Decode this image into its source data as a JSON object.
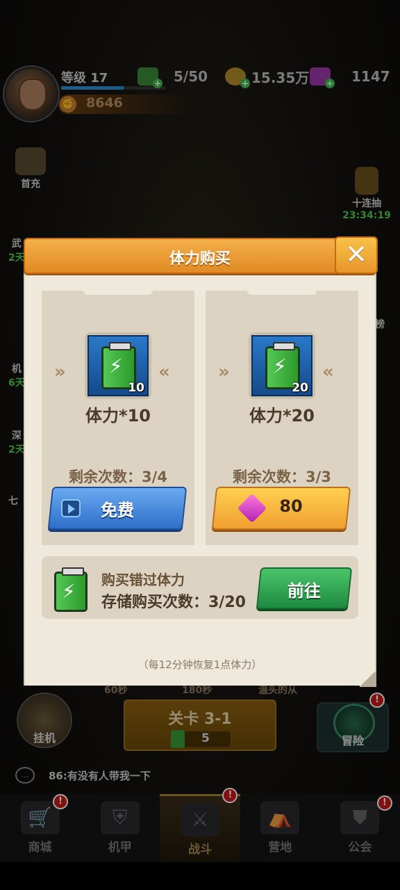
{
  "topbar": {
    "level_label": "等级 17",
    "power": "8646",
    "stamina": "5/50",
    "gold": "15.35万",
    "gems": "1147",
    "plus": "+"
  },
  "side_events": {
    "first_charge": "首充",
    "ten_draw": "十连抽",
    "ten_draw_timer": "23:34:19",
    "partial_left": [
      "武",
      "2天",
      "机",
      "6天",
      "深",
      "2天",
      "七"
    ],
    "partial_right": [
      "榜"
    ]
  },
  "bottom": {
    "hangup_label": "挂机",
    "stage_label": "关卡 3-1",
    "stage_cost": "5",
    "adventure_label": "冒险",
    "badge": "!",
    "behind_texts": [
      "60秒",
      "180秒",
      "温头的从"
    ],
    "chat_message": "86:有没有人带我一下",
    "chat_icon": "..."
  },
  "nav": {
    "items": [
      {
        "label": "商城",
        "icon": "cart-icon"
      },
      {
        "label": "机甲",
        "icon": "mech-icon"
      },
      {
        "label": "战斗",
        "icon": "battle-icon"
      },
      {
        "label": "营地",
        "icon": "camp-icon"
      },
      {
        "label": "公会",
        "icon": "guild-icon"
      }
    ],
    "active": "战斗"
  },
  "dialog": {
    "title": "体力购买",
    "close": "✕",
    "cards": [
      {
        "quantity": "10",
        "name": "体力*10",
        "remaining": "剩余次数：3/4",
        "button": "免费",
        "button_type": "free-video"
      },
      {
        "quantity": "20",
        "name": "体力*20",
        "remaining": "剩余次数：3/3",
        "button": "80",
        "button_type": "gem-cost"
      }
    ],
    "arrows_left": "»",
    "arrows_right": "«",
    "storage": {
      "line1": "购买错过体力",
      "line2": "存储购买次数：3/20",
      "button": "前往"
    },
    "footnote": "（每12分钟恢复1点体力）"
  },
  "colors": {
    "header_orange": "#e08a24",
    "panel_bg": "#efe9dc",
    "card_bg": "#dcd3c2",
    "free_blue": "#2e6ec8",
    "cost_orange": "#f0a030",
    "go_green": "#1e8a40"
  }
}
